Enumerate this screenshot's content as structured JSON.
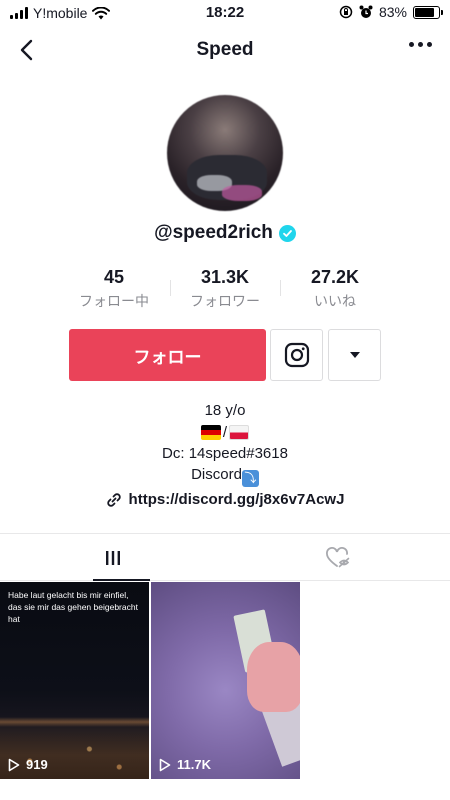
{
  "status_bar": {
    "carrier": "Y!mobile",
    "time": "18:22",
    "battery_percent": "83%",
    "battery_level": 0.83
  },
  "nav": {
    "title": "Speed"
  },
  "profile": {
    "username": "@speed2rich",
    "verified": true
  },
  "stats": [
    {
      "value": "45",
      "label": "フォロー中"
    },
    {
      "value": "31.3K",
      "label": "フォロワー"
    },
    {
      "value": "27.2K",
      "label": "いいね"
    }
  ],
  "actions": {
    "follow_label": "フォロー"
  },
  "bio": {
    "line1": "18 y/o",
    "flags_separator": "/",
    "line3": "Dc: 14speed#3618",
    "line4": "Discord"
  },
  "link": {
    "text": "https://discord.gg/j8x6v7AcwJ"
  },
  "videos": [
    {
      "caption": "Habe laut gelacht bis mir einfiel, das sie mir das gehen beigebracht hat",
      "plays": "919"
    },
    {
      "caption": "",
      "plays": "11.7K"
    }
  ],
  "colors": {
    "accent": "#ea4359",
    "verified": "#20d5ec",
    "muted_text": "#8a8b91"
  },
  "icons": {
    "back": "chevron-left-icon",
    "more": "ellipsis-icon",
    "instagram": "instagram-icon",
    "dropdown": "caret-down-icon",
    "link": "link-icon",
    "videos_tab": "grid-icon",
    "liked_tab": "hidden-heart-icon",
    "play": "play-icon"
  }
}
